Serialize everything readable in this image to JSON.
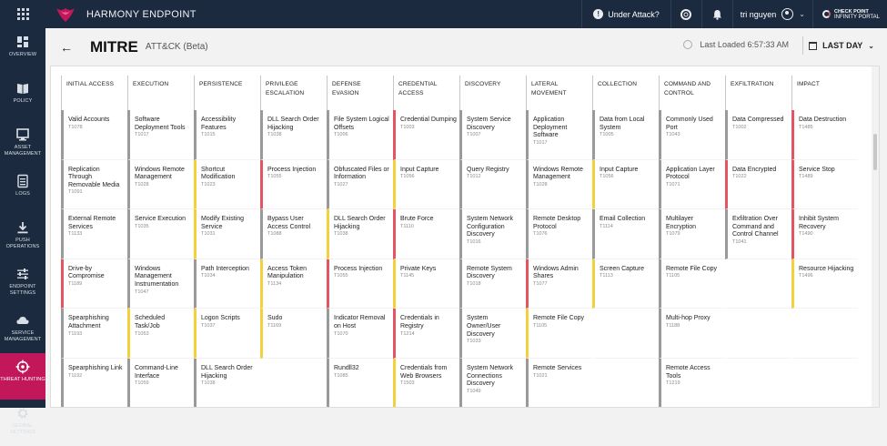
{
  "topbar": {
    "brand": "HARMONY ENDPOINT",
    "attack_label": "Under Attack?",
    "user_name": "tri nguyen",
    "vendor_line1": "CHECK POINT",
    "vendor_line2": "INFINITY PORTAL"
  },
  "sidebar": {
    "items": [
      {
        "label": "OVERVIEW",
        "icon": "dashboard-icon"
      },
      {
        "label": "POLICY",
        "icon": "book-icon"
      },
      {
        "label": "ASSET MANAGEMENT",
        "icon": "monitor-icon"
      },
      {
        "label": "LOGS",
        "icon": "list-icon"
      },
      {
        "label": "PUSH OPERATIONS",
        "icon": "download-icon"
      },
      {
        "label": "ENDPOINT SETTINGS",
        "icon": "sliders-icon"
      },
      {
        "label": "SERVICE MANAGEMENT",
        "icon": "cloud-icon"
      },
      {
        "label": "THREAT HUNTING",
        "icon": "crosshair-icon",
        "active": true
      },
      {
        "label": "GLOBAL SETTINGS",
        "icon": "gear-icon"
      }
    ]
  },
  "header": {
    "title": "MITRE",
    "subtitle": "ATT&CK (Beta)",
    "last_loaded": "Last Loaded 6:57:33 AM",
    "range": "LAST DAY"
  },
  "colors": {
    "red": "#e45564",
    "yellow": "#f2d13c",
    "gray": "#9a9a9a",
    "accent": "#c2185b",
    "nav": "#1b2a3e"
  },
  "matrix": {
    "columns": [
      {
        "title": "INITIAL ACCESS",
        "cells": [
          {
            "name": "Valid Accounts",
            "id": "T1078",
            "status": "gray"
          },
          {
            "name": "Replication Through Removable Media",
            "id": "T1091",
            "status": "gray"
          },
          {
            "name": "External Remote Services",
            "id": "T1133",
            "status": "gray"
          },
          {
            "name": "Drive-by Compromise",
            "id": "T1189",
            "status": "red"
          },
          {
            "name": "Spearphishing Attachment",
            "id": "T1193",
            "status": "gray"
          },
          {
            "name": "Spearphishing Link",
            "id": "T1192",
            "status": "gray"
          }
        ]
      },
      {
        "title": "EXECUTION",
        "cells": [
          {
            "name": "Software Deployment Tools",
            "id": "T1017",
            "status": "gray"
          },
          {
            "name": "Windows Remote Management",
            "id": "T1028",
            "status": "gray"
          },
          {
            "name": "Service Execution",
            "id": "T1035",
            "status": "gray"
          },
          {
            "name": "Windows Management Instrumentation",
            "id": "T1047",
            "status": "gray"
          },
          {
            "name": "Scheduled Task/Job",
            "id": "T1053",
            "status": "yellow"
          },
          {
            "name": "Command-Line Interface",
            "id": "T1059",
            "status": "gray"
          }
        ]
      },
      {
        "title": "PERSISTENCE",
        "cells": [
          {
            "name": "Accessibility Features",
            "id": "T1015",
            "status": "gray"
          },
          {
            "name": "Shortcut Modification",
            "id": "T1023",
            "status": "yellow"
          },
          {
            "name": "Modify Existing Service",
            "id": "T1031",
            "status": "yellow"
          },
          {
            "name": "Path Interception",
            "id": "T1034",
            "status": "gray"
          },
          {
            "name": "Logon Scripts",
            "id": "T1037",
            "status": "yellow"
          },
          {
            "name": "DLL Search Order Hijacking",
            "id": "T1038",
            "status": "gray"
          }
        ]
      },
      {
        "title": "PRIVILEGE ESCALATION",
        "cells": [
          {
            "name": "DLL Search Order Hijacking",
            "id": "T1038",
            "status": "gray"
          },
          {
            "name": "Process Injection",
            "id": "T1055",
            "status": "red"
          },
          {
            "name": "Bypass User Access Control",
            "id": "T1088",
            "status": "gray"
          },
          {
            "name": "Access Token Manipulation",
            "id": "T1134",
            "status": "yellow"
          },
          {
            "name": "Sudo",
            "id": "T1169",
            "status": "yellow"
          },
          {
            "name": "",
            "id": "",
            "status": "empty"
          }
        ]
      },
      {
        "title": "DEFENSE EVASION",
        "cells": [
          {
            "name": "File System Logical Offsets",
            "id": "T1006",
            "status": "gray"
          },
          {
            "name": "Obfuscated Files or Information",
            "id": "T1027",
            "status": "gray"
          },
          {
            "name": "DLL Search Order Hijacking",
            "id": "T1038",
            "status": "yellow"
          },
          {
            "name": "Process Injection",
            "id": "T1055",
            "status": "red"
          },
          {
            "name": "Indicator Removal on Host",
            "id": "T1070",
            "status": "gray"
          },
          {
            "name": "Rundll32",
            "id": "T1085",
            "status": "gray"
          }
        ]
      },
      {
        "title": "CREDENTIAL ACCESS",
        "cells": [
          {
            "name": "Credential Dumping",
            "id": "T1003",
            "status": "red"
          },
          {
            "name": "Input Capture",
            "id": "T1056",
            "status": "yellow"
          },
          {
            "name": "Brute Force",
            "id": "T1110",
            "status": "red"
          },
          {
            "name": "Private Keys",
            "id": "T1145",
            "status": "yellow"
          },
          {
            "name": "Credentials in Registry",
            "id": "T1214",
            "status": "red"
          },
          {
            "name": "Credentials from Web Browsers",
            "id": "T1503",
            "status": "yellow"
          }
        ]
      },
      {
        "title": "DISCOVERY",
        "cells": [
          {
            "name": "System Service Discovery",
            "id": "T1007",
            "status": "gray"
          },
          {
            "name": "Query Registry",
            "id": "T1012",
            "status": "gray"
          },
          {
            "name": "System Network Configuration Discovery",
            "id": "T1016",
            "status": "gray"
          },
          {
            "name": "Remote System Discovery",
            "id": "T1018",
            "status": "gray"
          },
          {
            "name": "System Owner/User Discovery",
            "id": "T1033",
            "status": "gray"
          },
          {
            "name": "System Network Connections Discovery",
            "id": "T1049",
            "status": "gray"
          }
        ]
      },
      {
        "title": "LATERAL MOVEMENT",
        "cells": [
          {
            "name": "Application Deployment Software",
            "id": "T1017",
            "status": "gray"
          },
          {
            "name": "Windows Remote Management",
            "id": "T1028",
            "status": "gray"
          },
          {
            "name": "Remote Desktop Protocol",
            "id": "T1076",
            "status": "gray"
          },
          {
            "name": "Windows Admin Shares",
            "id": "T1077",
            "status": "red"
          },
          {
            "name": "Remote File Copy",
            "id": "T1105",
            "status": "yellow"
          },
          {
            "name": "Remote Services",
            "id": "T1021",
            "status": "gray"
          }
        ]
      },
      {
        "title": "COLLECTION",
        "cells": [
          {
            "name": "Data from Local System",
            "id": "T1005",
            "status": "gray"
          },
          {
            "name": "Input Capture",
            "id": "T1056",
            "status": "yellow"
          },
          {
            "name": "Email Collection",
            "id": "T1114",
            "status": "gray"
          },
          {
            "name": "Screen Capture",
            "id": "T1113",
            "status": "yellow"
          },
          {
            "name": "",
            "id": "",
            "status": "empty"
          },
          {
            "name": "",
            "id": "",
            "status": "empty"
          }
        ]
      },
      {
        "title": "COMMAND AND CONTROL",
        "cells": [
          {
            "name": "Commonly Used Port",
            "id": "T1043",
            "status": "gray"
          },
          {
            "name": "Application Layer Protocol",
            "id": "T1071",
            "status": "gray"
          },
          {
            "name": "Multilayer Encryption",
            "id": "T1079",
            "status": "gray"
          },
          {
            "name": "Remote File Copy",
            "id": "T1105",
            "status": "gray"
          },
          {
            "name": "Multi-hop Proxy",
            "id": "T1188",
            "status": "gray"
          },
          {
            "name": "Remote Access Tools",
            "id": "T1219",
            "status": "gray"
          }
        ]
      },
      {
        "title": "EXFILTRATION",
        "cells": [
          {
            "name": "Data Compressed",
            "id": "T1002",
            "status": "gray"
          },
          {
            "name": "Data Encrypted",
            "id": "T1022",
            "status": "red"
          },
          {
            "name": "Exfiltration Over Command and Control Channel",
            "id": "T1041",
            "status": "gray"
          },
          {
            "name": "",
            "id": "",
            "status": "empty"
          },
          {
            "name": "",
            "id": "",
            "status": "empty"
          },
          {
            "name": "",
            "id": "",
            "status": "empty"
          }
        ]
      },
      {
        "title": "IMPACT",
        "cells": [
          {
            "name": "Data Destruction",
            "id": "T1485",
            "status": "red"
          },
          {
            "name": "Service Stop",
            "id": "T1489",
            "status": "red"
          },
          {
            "name": "Inhibit System Recovery",
            "id": "T1490",
            "status": "red"
          },
          {
            "name": "Resource Hijacking",
            "id": "T1496",
            "status": "yellow"
          },
          {
            "name": "",
            "id": "",
            "status": "empty"
          },
          {
            "name": "",
            "id": "",
            "status": "empty"
          }
        ]
      }
    ]
  }
}
